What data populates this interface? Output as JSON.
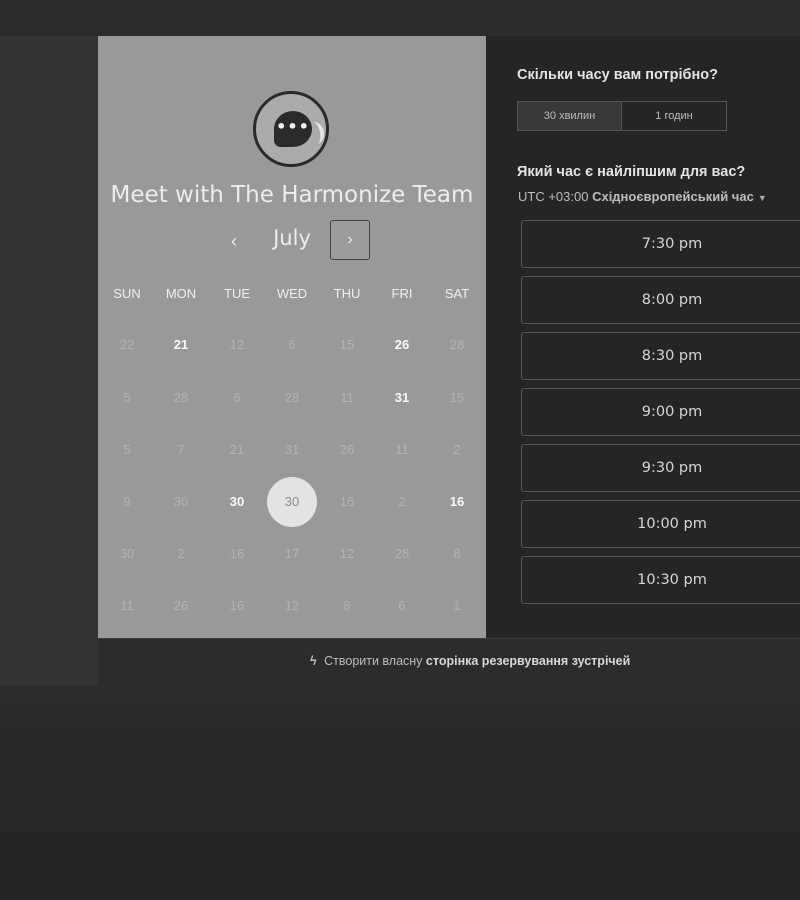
{
  "scheduler": {
    "title": "Meet with The Harmonize Team",
    "logo_icon": "chat-bubble-icon",
    "month": "July",
    "prev_icon": "chevron-left-icon",
    "next_icon": "chevron-right-icon",
    "prev_glyph": "‹",
    "next_glyph": "›",
    "weekdays": [
      "SUN",
      "MON",
      "TUE",
      "WED",
      "THU",
      "FRI",
      "SAT"
    ],
    "weeks": [
      [
        "22",
        "21",
        "12",
        "6",
        "15",
        "26",
        "28"
      ],
      [
        "5",
        "28",
        "6",
        "28",
        "11",
        "31",
        "15"
      ],
      [
        "5",
        "7",
        "21",
        "31",
        "26",
        "11",
        "2"
      ],
      [
        "9",
        "30",
        "30",
        "30",
        "16",
        "2",
        "16"
      ],
      [
        "30",
        "2",
        "16",
        "17",
        "12",
        "28",
        "8"
      ],
      [
        "11",
        "26",
        "16",
        "12",
        "8",
        "6",
        "1"
      ]
    ],
    "selected_day": "30"
  },
  "booking": {
    "duration_question": "Скільки часу вам потрібно?",
    "durations": [
      "30 хвилин",
      "1 годин"
    ],
    "selected_duration": "30 хвилин",
    "time_question": "Який час є найліпшим для вас?",
    "timezone_offset": "UTC +03:00",
    "timezone_name": "Східноєвропейський час",
    "caret_icon": "caret-down-icon",
    "slots": [
      "7:30 pm",
      "8:00 pm",
      "8:30 pm",
      "9:00 pm",
      "9:30 pm",
      "10:00 pm",
      "10:30 pm"
    ]
  },
  "footer": {
    "icon": "hubspot-sprocket-icon",
    "prefix": "Створити власну",
    "link": "сторінка резервування зустрічей"
  },
  "colors": {
    "calendar_bg": "#999999",
    "panel_bg": "#252525",
    "selected_day_bg": "#e3e3e3"
  }
}
